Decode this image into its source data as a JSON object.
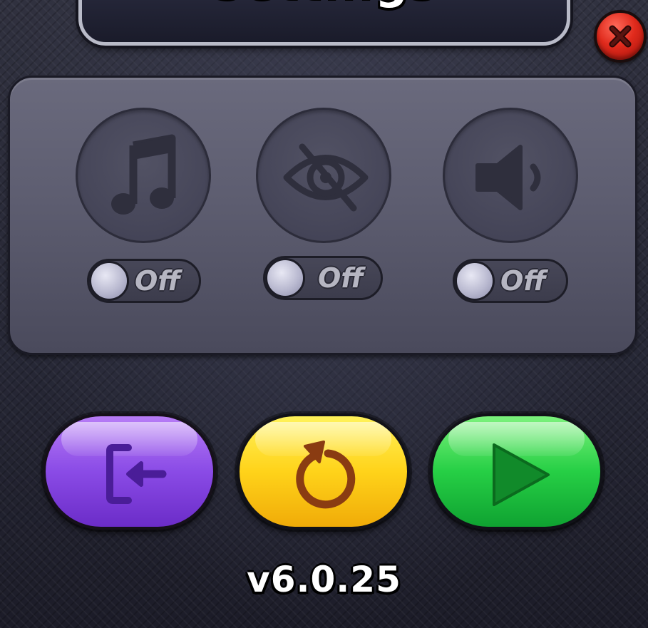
{
  "header": {
    "title": "Settings"
  },
  "close_button": {
    "icon": "close-icon",
    "color": "#e02a1c"
  },
  "options": [
    {
      "id": "music",
      "icon": "music-note-icon",
      "toggle_label": "Off",
      "enabled": false
    },
    {
      "id": "visibility",
      "icon": "eye-slash-icon",
      "toggle_label": "Off",
      "enabled": false
    },
    {
      "id": "sound",
      "icon": "speaker-icon",
      "toggle_label": "Off",
      "enabled": false
    }
  ],
  "actions": [
    {
      "id": "exit",
      "icon": "exit-door-icon",
      "color": "#8a4be6"
    },
    {
      "id": "restart",
      "icon": "restart-icon",
      "color": "#ffd31a"
    },
    {
      "id": "resume",
      "icon": "play-icon",
      "color": "#26cf45"
    }
  ],
  "footer": {
    "version": "v6.0.25"
  }
}
